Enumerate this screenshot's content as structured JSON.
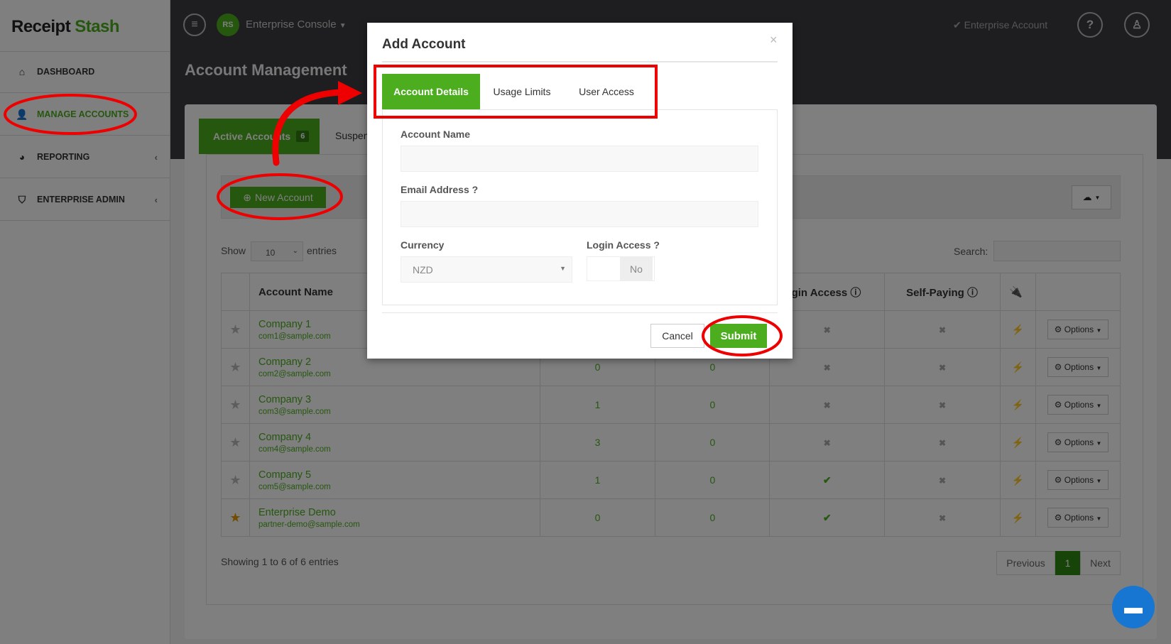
{
  "app": {
    "logo_text_1": "Receipt",
    "logo_text_2": "Stash",
    "console_label": "Enterprise Console",
    "account_type": "Enterprise Account",
    "brand_color": "#4cae1f"
  },
  "sidebar": {
    "items": [
      {
        "label": "DASHBOARD",
        "icon": "home-icon"
      },
      {
        "label": "MANAGE ACCOUNTS",
        "icon": "user-gear-icon",
        "active": true
      },
      {
        "label": "REPORTING",
        "icon": "pie-chart-icon"
      },
      {
        "label": "ENTERPRISE ADMIN",
        "icon": "shield-icon"
      }
    ]
  },
  "main": {
    "title": "Account Management",
    "tabs": [
      {
        "label": "Active Accounts",
        "count": "6"
      },
      {
        "label": "Suspen"
      }
    ],
    "new_account_label": "New Account",
    "show_label": "Show",
    "entries_label": "entries",
    "page_size": "10",
    "search_label": "Search:",
    "table": {
      "headers": [
        "",
        "Account Name",
        "",
        "",
        "Login Access",
        "Self-Paying",
        "",
        ""
      ],
      "rows": [
        {
          "name": "Company 1",
          "email": "com1@sample.com",
          "c3": "",
          "c4": "",
          "login": false,
          "self": false,
          "fav": false
        },
        {
          "name": "Company 2",
          "email": "com2@sample.com",
          "c3": "0",
          "c4": "0",
          "login": false,
          "self": false,
          "fav": false
        },
        {
          "name": "Company 3",
          "email": "com3@sample.com",
          "c3": "1",
          "c4": "0",
          "login": false,
          "self": false,
          "fav": false
        },
        {
          "name": "Company 4",
          "email": "com4@sample.com",
          "c3": "3",
          "c4": "0",
          "login": false,
          "self": false,
          "fav": false
        },
        {
          "name": "Company 5",
          "email": "com5@sample.com",
          "c3": "1",
          "c4": "0",
          "login": true,
          "self": false,
          "fav": false
        },
        {
          "name": "Enterprise Demo",
          "email": "partner-demo@sample.com",
          "c3": "0",
          "c4": "0",
          "login": true,
          "self": false,
          "fav": true
        }
      ],
      "options_label": "Options"
    },
    "showing": "Showing 1 to 6 of 6 entries",
    "pager": {
      "prev": "Previous",
      "current": "1",
      "next": "Next"
    }
  },
  "modal": {
    "title": "Add Account",
    "close": "×",
    "tabs": [
      "Account Details",
      "Usage Limits",
      "User Access"
    ],
    "account_name_label": "Account Name",
    "account_name_value": "",
    "email_label": "Email Address",
    "email_value": "",
    "currency_label": "Currency",
    "currency_value": "NZD",
    "login_access_label": "Login Access",
    "login_access_value": "No",
    "cancel": "Cancel",
    "submit": "Submit"
  }
}
